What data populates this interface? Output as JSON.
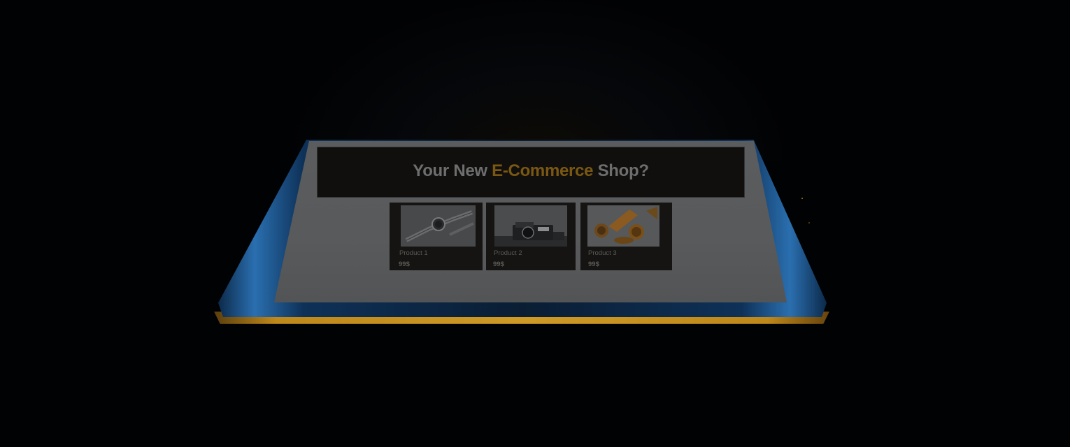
{
  "hero": {
    "title_before": "Your New ",
    "title_accent": "E-Commerce",
    "title_after": " Shop?"
  },
  "products": [
    {
      "name": "Product 1",
      "price": "99$",
      "image": "smartwatch"
    },
    {
      "name": "Product 2",
      "price": "99$",
      "image": "camera"
    },
    {
      "name": "Product 3",
      "price": "99$",
      "image": "citrus-fruit"
    }
  ],
  "colors": {
    "accent": "#f2b62e",
    "device_edge": "#2a6fb0",
    "background": "#010203"
  }
}
